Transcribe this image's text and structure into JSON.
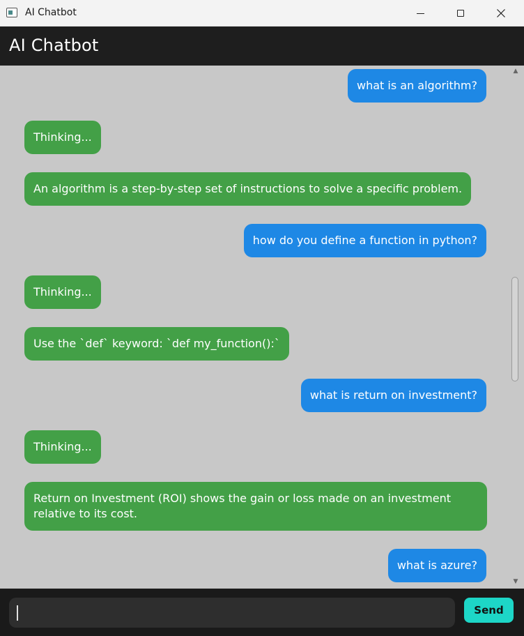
{
  "window": {
    "title": "AI Chatbot"
  },
  "header": {
    "title": "AI Chatbot"
  },
  "messages": [
    {
      "role": "user",
      "text": "what is an algorithm?"
    },
    {
      "role": "bot",
      "text": "Thinking..."
    },
    {
      "role": "bot",
      "text": "An algorithm is a step-by-step set of instructions to solve a specific problem."
    },
    {
      "role": "user",
      "text": "how do you define a function in python?"
    },
    {
      "role": "bot",
      "text": "Thinking..."
    },
    {
      "role": "bot",
      "text": "Use the `def` keyword: `def my_function():`"
    },
    {
      "role": "user",
      "text": "what is return on investment?"
    },
    {
      "role": "bot",
      "text": "Thinking..."
    },
    {
      "role": "bot",
      "text": "Return on Investment (ROI) shows the gain or loss made on an investment relative to its cost."
    },
    {
      "role": "user",
      "text": "what is azure?"
    }
  ],
  "input": {
    "value": "",
    "send_label": "Send"
  },
  "colors": {
    "user_bubble": "#1e88e5",
    "bot_bubble": "#43a047",
    "send_button": "#1dd6c7",
    "header_bg": "#1e1e1e",
    "chat_bg": "#c8c8c8"
  }
}
